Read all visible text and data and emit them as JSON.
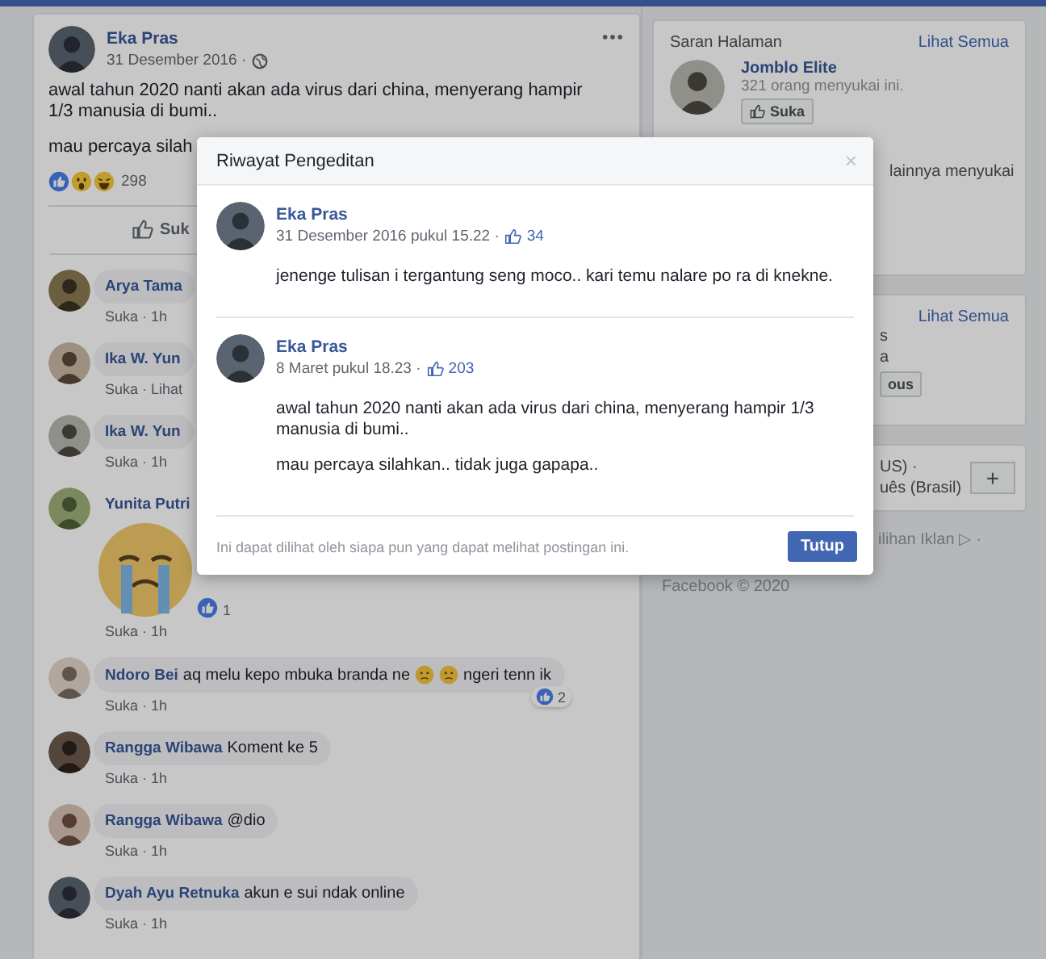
{
  "post": {
    "author": "Eka Pras",
    "date": "31 Desember 2016 ·",
    "paragraphs": [
      "awal tahun 2020 nanti akan ada virus dari china, menyerang hampir 1/3 manusia di bumi..",
      "mau percaya silah"
    ],
    "reaction_count": "298",
    "action": "Suk"
  },
  "comments": [
    {
      "kind": "text",
      "author": "Arya Tama",
      "meta": "Suka · 1h"
    },
    {
      "kind": "text",
      "author": "Ika W. Yun",
      "meta": "Suka · Lihat"
    },
    {
      "kind": "text",
      "author": "Ika W. Yun",
      "meta": "Suka · 1h"
    },
    {
      "kind": "sticker",
      "author": "Yunita Putri",
      "reaction_count": "1",
      "meta": "Suka · 1h"
    },
    {
      "kind": "text",
      "author": "Ndoro Bei",
      "segments": [
        {
          "kind": "text",
          "text": "aq melu kepo mbuka branda ne"
        },
        {
          "kind": "emoji"
        },
        {
          "kind": "emoji"
        },
        {
          "kind": "text",
          "text": "ngeri tenn ik"
        }
      ],
      "reaction_count": "2",
      "meta": "Suka · 1h"
    },
    {
      "kind": "text",
      "author": "Rangga Wibawa",
      "segments": [
        {
          "kind": "text",
          "text": "Koment ke 5"
        }
      ],
      "meta": "Suka · 1h"
    },
    {
      "kind": "text",
      "author": "Rangga Wibawa",
      "segments": [
        {
          "kind": "text",
          "text": "@dio"
        }
      ],
      "meta": "Suka · 1h"
    },
    {
      "kind": "text",
      "author": "Dyah Ayu Retnuka",
      "segments": [
        {
          "kind": "text",
          "text": "akun e sui ndak online"
        }
      ],
      "meta": "Suka · 1h"
    }
  ],
  "sidebar": {
    "cards": [
      {
        "kind": "suggestions",
        "title": "Saran Halaman",
        "link": "Lihat Semua",
        "page_name": "Jomblo Elite",
        "page_likes": "321 orang menyukai ini.",
        "button": "Suka",
        "note": "lainnya menyukai"
      },
      {
        "kind": "partial",
        "link": "Lihat Semua",
        "lines": [
          "s",
          "a"
        ],
        "button": "ous"
      },
      {
        "kind": "language",
        "lines": [
          "US) ·",
          "uês (Brasil)"
        ],
        "button": "+"
      }
    ],
    "footer_lines": [
      "ilihan Iklan ▷ ·",
      "Facebook © 2020"
    ]
  },
  "dialog": {
    "title": "Riwayat Pengeditan",
    "close": "×",
    "entries": [
      {
        "author": "Eka Pras",
        "timestamp": "31 Desember 2016 pukul 15.22 ·",
        "likes": "34",
        "paragraphs": [
          "jenenge tulisan i tergantung seng moco.. kari temu nalare po ra di knekne."
        ]
      },
      {
        "author": "Eka Pras",
        "timestamp": "8 Maret pukul 18.23 ·",
        "likes": "203",
        "paragraphs": [
          "awal tahun 2020 nanti akan ada virus dari china, menyerang hampir 1/3 manusia di bumi..",
          "mau percaya silahkan.. tidak juga gapapa.."
        ]
      }
    ],
    "footer_note": "Ini dapat dilihat oleh siapa pun yang dapat melihat postingan ini.",
    "button": "Tutup"
  }
}
